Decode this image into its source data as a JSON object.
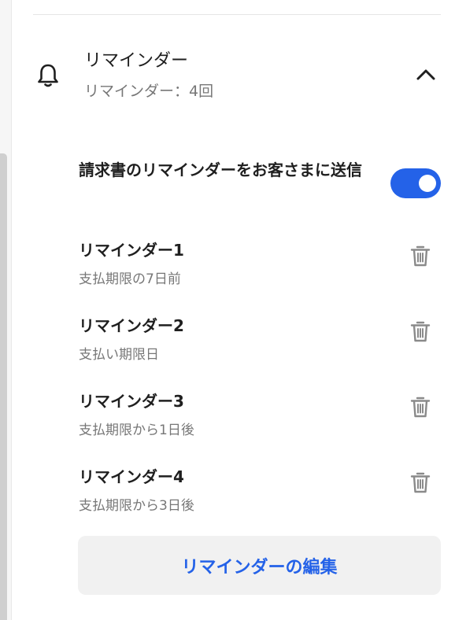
{
  "header": {
    "title": "リマインダー",
    "subtitle": "リマインダー：4回",
    "icon": "bell-icon",
    "collapse_icon": "chevron-up-icon"
  },
  "toggle": {
    "label": "請求書のリマインダーをお客さまに送信",
    "enabled": true,
    "color": "#2462e8"
  },
  "reminders": [
    {
      "title": "リマインダー1",
      "detail": "支払期限の7日前"
    },
    {
      "title": "リマインダー2",
      "detail": "支払い期限日"
    },
    {
      "title": "リマインダー3",
      "detail": "支払期限から1日後"
    },
    {
      "title": "リマインダー4",
      "detail": "支払期限から3日後"
    }
  ],
  "edit_button": {
    "label": "リマインダーの編集"
  }
}
